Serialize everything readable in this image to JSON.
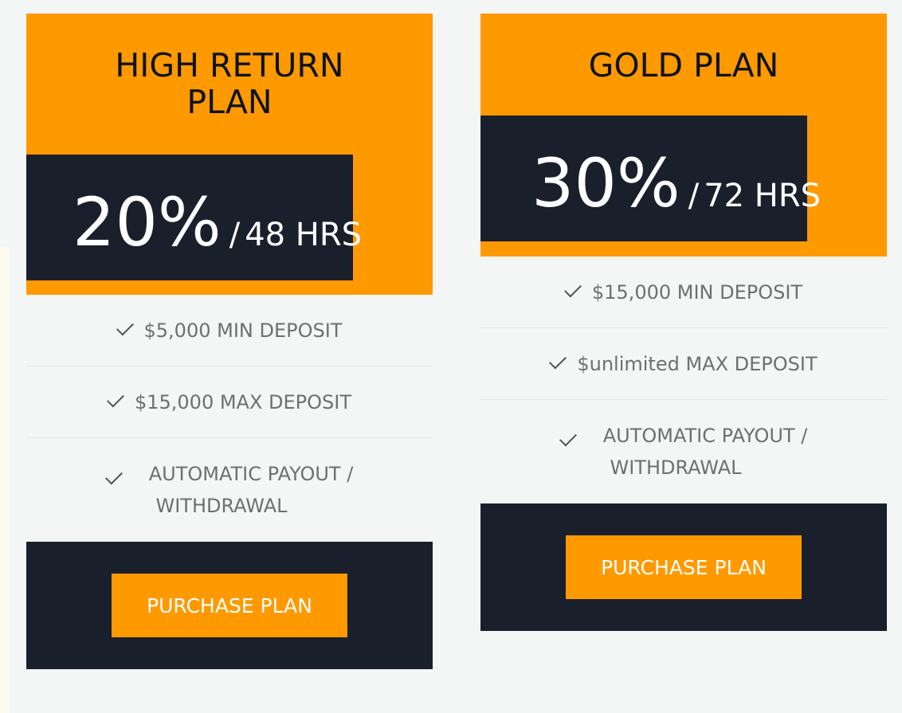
{
  "plans": [
    {
      "title": "HIGH RETURN PLAN",
      "rate": "20%",
      "separator": "/",
      "period": "48 HRS",
      "features": [
        "$5,000 MIN DEPOSIT",
        "$15,000 MAX DEPOSIT",
        "AUTOMATIC PAYOUT / WITHDRAWAL"
      ],
      "button_label": "PURCHASE PLAN"
    },
    {
      "title": "GOLD PLAN",
      "rate": "30%",
      "separator": "/",
      "period": "72 HRS",
      "features": [
        "$15,000 MIN DEPOSIT",
        "$unlimited MAX DEPOSIT",
        "AUTOMATIC PAYOUT / WITHDRAWAL"
      ],
      "button_label": "PURCHASE PLAN"
    }
  ],
  "icons": {
    "feature": "check-icon"
  },
  "colors": {
    "accent": "#ff9900",
    "dark": "#1a1f2c",
    "background": "#f4f6f6",
    "feature_text": "#6f6f6f"
  }
}
